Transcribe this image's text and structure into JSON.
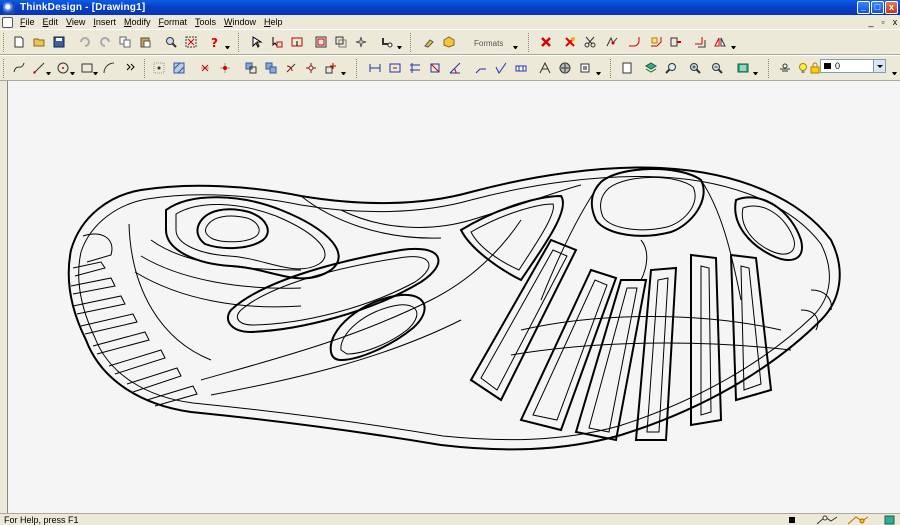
{
  "window": {
    "title": "ThinkDesign  - [Drawing1]"
  },
  "window_controls": {
    "minimize": "_",
    "maximize": "□",
    "close": "x"
  },
  "mdi_controls": {
    "minimize": "_",
    "restore": "▫",
    "close": "x"
  },
  "menu": [
    "File",
    "Edit",
    "View",
    "Insert",
    "Modify",
    "Format",
    "Tools",
    "Window",
    "Help"
  ],
  "toolbar": {
    "formats_label": "Formats"
  },
  "layer": {
    "value": "0"
  },
  "status": {
    "text": "For Help, press F1"
  },
  "colors": {
    "titlebar": "#0a46d4",
    "canvas": "#f5f5f5",
    "chrome": "#ece9d8",
    "undo_icon": "#c00000"
  }
}
